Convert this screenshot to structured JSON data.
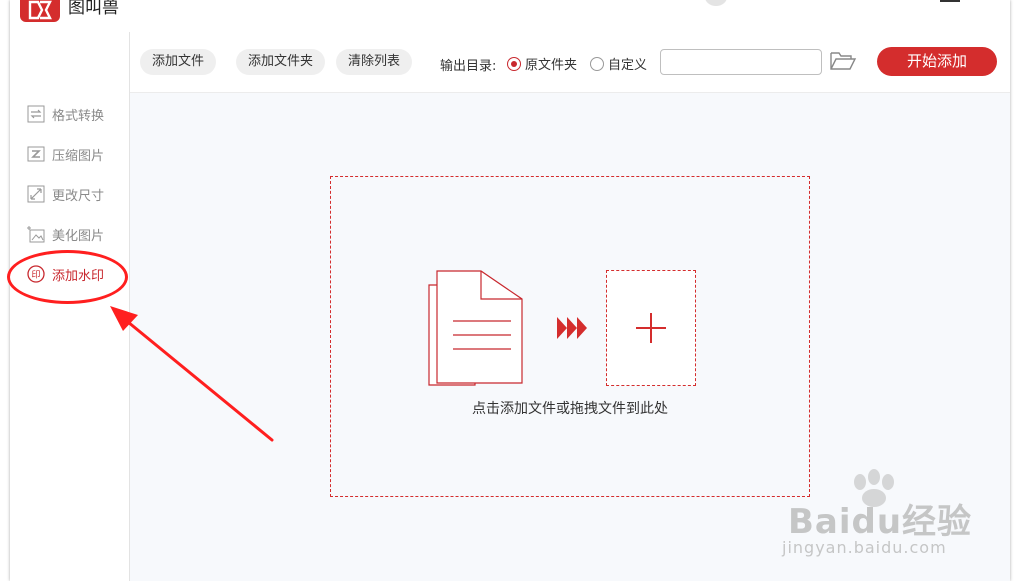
{
  "app": {
    "title": "图叫兽",
    "logo_icon": "app-logo-icon",
    "brand_color": "#d42d2d"
  },
  "sidebar": {
    "items": [
      {
        "label": "格式转换",
        "icon": "convert-icon"
      },
      {
        "label": "压缩图片",
        "icon": "compress-icon"
      },
      {
        "label": "更改尺寸",
        "icon": "resize-icon"
      },
      {
        "label": "美化图片",
        "icon": "beautify-icon"
      },
      {
        "label": "添加水印",
        "icon": "watermark-stamp-icon",
        "active": true
      }
    ]
  },
  "toolbar": {
    "add_file": "添加文件",
    "add_folder": "添加文件夹",
    "clear_list": "清除列表",
    "output_label": "输出目录:",
    "radio_original": "原文件夹",
    "radio_custom": "自定义",
    "selected_output": "原文件夹",
    "path_value": "",
    "path_placeholder": "",
    "folder_icon": "folder-open-icon",
    "start_button": "开始添加"
  },
  "dropzone": {
    "hint": "点击添加文件或拖拽文件到此处",
    "icons": [
      "documents-icon",
      "triple-arrow-icon",
      "plus-icon"
    ]
  },
  "watermark": {
    "main": "Baidu经验",
    "sub": "jingyan.baidu.com"
  },
  "annotation": {
    "color": "#ff1f1f"
  }
}
